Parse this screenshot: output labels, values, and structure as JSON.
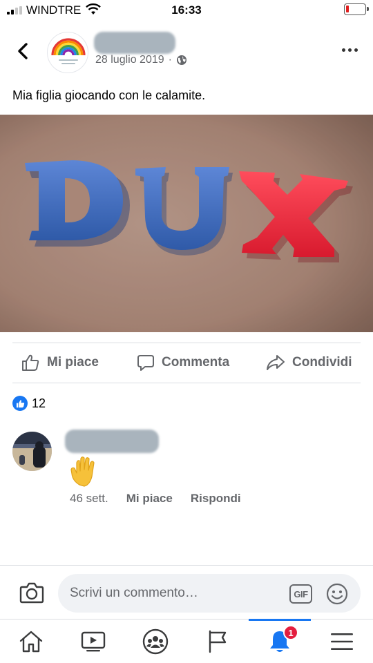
{
  "status_bar": {
    "carrier": "WINDTRE",
    "time": "16:33"
  },
  "post": {
    "date": "28 luglio 2019",
    "date_separator": "·",
    "caption": "Mia figlia giocando con le calamite.",
    "photo_letters": [
      "D",
      "U",
      "X"
    ]
  },
  "actions": {
    "like": "Mi piace",
    "comment": "Commenta",
    "share": "Condividi"
  },
  "reactions": {
    "count": "12"
  },
  "comment": {
    "time": "46 sett.",
    "like": "Mi piace",
    "reply": "Rispondi"
  },
  "composer": {
    "placeholder": "Scrivi un commento…",
    "gif_label": "GIF"
  },
  "tabbar": {
    "notifications_badge": "1"
  },
  "colors": {
    "accent": "#1877f2",
    "letter_blue": "#3d6bc1",
    "letter_red": "#f0283a",
    "badge_red": "#e41e3f"
  }
}
